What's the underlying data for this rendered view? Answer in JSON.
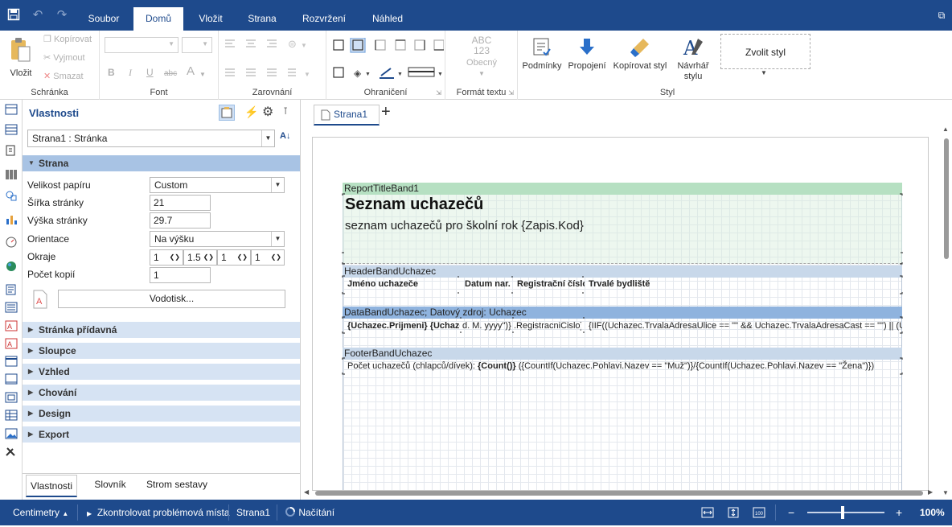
{
  "ribbon_tabs": [
    "Soubor",
    "Domů",
    "Vložit",
    "Strana",
    "Rozvržení",
    "Náhled"
  ],
  "ribbon": {
    "schranka": {
      "label": "Schránka",
      "paste": "Vložit",
      "copy": "Kopírovat",
      "cut": "Vyjmout",
      "delete": "Smazat"
    },
    "font": {
      "label": "Font"
    },
    "zarovnani": {
      "label": "Zarovnání"
    },
    "ohraniceni": {
      "label": "Ohraničení"
    },
    "format": {
      "label": "Formát textu",
      "sample_top": "ABC",
      "sample_num": "123",
      "sample_label": "Obecný"
    },
    "styl": {
      "label": "Styl",
      "conditions": "Podmínky",
      "links": "Propojení",
      "copy_style": "Kopírovat styl",
      "designer_1": "Návrhář",
      "designer_2": "stylu",
      "choose_style": "Zvolit styl"
    }
  },
  "panel": {
    "title": "Vlastnosti",
    "selected_object": "Strana1 : Stránka",
    "categories": {
      "strana": "Strana",
      "stranka_pridavna": "Stránka přídavná",
      "sloupce": "Sloupce",
      "vzhled": "Vzhled",
      "chovani": "Chování",
      "design": "Design",
      "export": "Export"
    },
    "props": {
      "paper_size_label": "Velikost papíru",
      "paper_size_value": "Custom",
      "width_label": "Šířka stránky",
      "width_value": "21",
      "height_label": "Výška stránky",
      "height_value": "29.7",
      "orientation_label": "Orientace",
      "orientation_value": "Na výšku",
      "margins_label": "Okraje",
      "margin_1": "1",
      "margin_2": "1.5",
      "margin_3": "1",
      "margin_4": "1",
      "copies_label": "Počet kopií",
      "copies_value": "1",
      "watermark_button": "Vodotisk..."
    },
    "bottom_tabs": [
      "Vlastnosti",
      "Slovník",
      "Strom sestavy"
    ]
  },
  "designer": {
    "page_tab": "Strana1",
    "title_band": {
      "name": "ReportTitleBand1",
      "heading": "Seznam uchazečů",
      "subtitle": "seznam uchazečů pro školní rok {Zapis.Kod}",
      "color": "#b6e0c2"
    },
    "header_band": {
      "name": "HeaderBandUchazec",
      "columns": [
        "Jméno uchazeče",
        "Datum nar.",
        "Registrační číslo",
        "Trvalé bydliště"
      ],
      "color": "#c8d8ea"
    },
    "data_band": {
      "name": "DataBandUchazec; Datový zdroj: Uchazec",
      "cells": [
        "{Uchazec.Prijmeni} {Uchazec.",
        "d. M. yyyy\")}",
        ".RegistracniCislo}",
        "{IIF((Uchazec.TrvalaAdresaUlice == \"\" && Uchazec.TrvalaAdresaCast == \"\") || (Uchazec"
      ],
      "color": "#8fb3de"
    },
    "footer_band": {
      "name": "FooterBandUchazec",
      "text_plain": "Počet uchazečů (chlapců/dívek): ",
      "text_bold": "{Count()}",
      "text_rest": " ({CountIf(Uchazec.Pohlavi.Nazev == \"Muž\")}/{CountIf(Uchazec.Pohlavi.Nazev == \"Žena\")})",
      "color": "#c8d8ea"
    }
  },
  "statusbar": {
    "units": "Centimetry",
    "check": "Zkontrolovat problémová místa",
    "page": "Strana1",
    "loading": "Načítání",
    "zoom": "100%"
  },
  "colors": {
    "accent": "#1e4a8c"
  }
}
